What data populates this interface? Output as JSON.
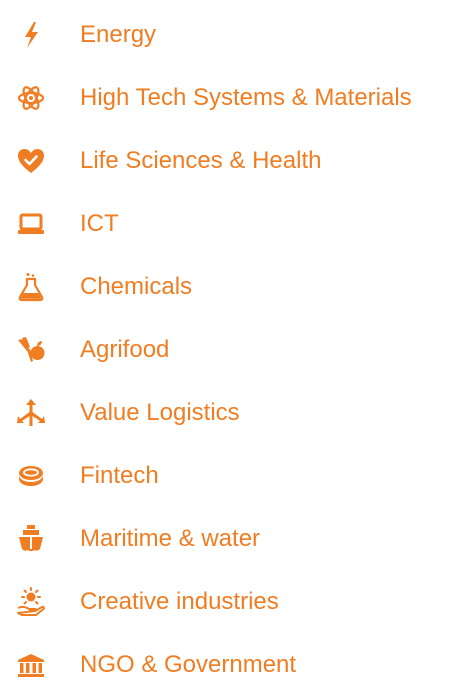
{
  "accent_color": "#f07d22",
  "sectors": [
    {
      "label": "Energy",
      "icon": "lightning-bolt-icon"
    },
    {
      "label": "High Tech Systems & Materials",
      "icon": "atom-icon"
    },
    {
      "label": "Life Sciences & Health",
      "icon": "heart-check-icon"
    },
    {
      "label": "ICT",
      "icon": "laptop-icon"
    },
    {
      "label": "Chemicals",
      "icon": "flask-icon"
    },
    {
      "label": "Agrifood",
      "icon": "vegetables-icon"
    },
    {
      "label": "Value Logistics",
      "icon": "split-arrows-icon"
    },
    {
      "label": "Fintech",
      "icon": "coins-icon"
    },
    {
      "label": "Maritime & water",
      "icon": "ship-icon"
    },
    {
      "label": "Creative industries",
      "icon": "lightbulb-hand-icon"
    },
    {
      "label": "NGO & Government",
      "icon": "government-building-icon"
    }
  ]
}
